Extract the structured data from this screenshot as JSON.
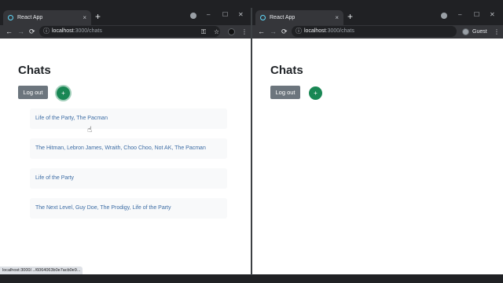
{
  "left_window": {
    "tab_title": "React App",
    "new_tab": "+",
    "controls": {
      "minimize": "–",
      "maximize": "☐",
      "close": "✕"
    },
    "url_host": "localhost",
    "url_path": ":3000/chats",
    "page": {
      "title": "Chats",
      "logout_label": "Log out",
      "add_label": "+",
      "chats": [
        "Life of the Party, The Pacman",
        "The Hitman, Lebron James, Wraith, Choo Choo, Not AK, The Pacman",
        "Life of the Party",
        "The Next Level, Guy Doe, The Prodigy, Life of the Party"
      ]
    },
    "status_bar": "localhost:3000/.../6064063b0e7acb0e9..."
  },
  "right_window": {
    "tab_title": "React App",
    "new_tab": "+",
    "controls": {
      "minimize": "–",
      "maximize": "☐",
      "close": "✕"
    },
    "url_host": "localhost",
    "url_path": ":3000/chats",
    "profile_label": "Guest",
    "page": {
      "title": "Chats",
      "logout_label": "Log out",
      "add_label": "+"
    }
  },
  "icons": {
    "back": "←",
    "forward": "→",
    "reload": "⟳",
    "info": "ⓘ",
    "key": "⚿",
    "star": "☆",
    "menu": "⋮",
    "tab_close": "×",
    "cursor": "☝"
  },
  "colors": {
    "chrome_dark": "#202124",
    "toolbar": "#35363a",
    "logout_button": "#6c757d",
    "add_button": "#198754",
    "chat_link": "#3d6da5",
    "chat_bg": "#f8f9fa"
  }
}
